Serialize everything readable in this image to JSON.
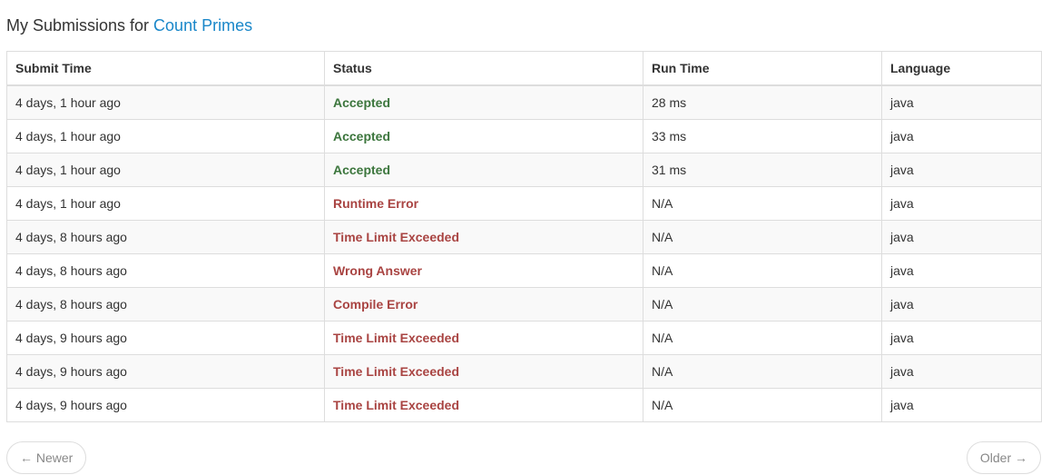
{
  "header": {
    "prefix": "My Submissions for ",
    "problem_link": "Count Primes"
  },
  "table": {
    "columns": [
      "Submit Time",
      "Status",
      "Run Time",
      "Language"
    ],
    "rows": [
      {
        "time": "4 days, 1 hour ago",
        "status": "Accepted",
        "runtime": "28 ms",
        "language": "java"
      },
      {
        "time": "4 days, 1 hour ago",
        "status": "Accepted",
        "runtime": "33 ms",
        "language": "java"
      },
      {
        "time": "4 days, 1 hour ago",
        "status": "Accepted",
        "runtime": "31 ms",
        "language": "java"
      },
      {
        "time": "4 days, 1 hour ago",
        "status": "Runtime Error",
        "runtime": "N/A",
        "language": "java"
      },
      {
        "time": "4 days, 8 hours ago",
        "status": "Time Limit Exceeded",
        "runtime": "N/A",
        "language": "java"
      },
      {
        "time": "4 days, 8 hours ago",
        "status": "Wrong Answer",
        "runtime": "N/A",
        "language": "java"
      },
      {
        "time": "4 days, 8 hours ago",
        "status": "Compile Error",
        "runtime": "N/A",
        "language": "java"
      },
      {
        "time": "4 days, 9 hours ago",
        "status": "Time Limit Exceeded",
        "runtime": "N/A",
        "language": "java"
      },
      {
        "time": "4 days, 9 hours ago",
        "status": "Time Limit Exceeded",
        "runtime": "N/A",
        "language": "java"
      },
      {
        "time": "4 days, 9 hours ago",
        "status": "Time Limit Exceeded",
        "runtime": "N/A",
        "language": "java"
      }
    ]
  },
  "pager": {
    "newer_arrow": "←",
    "newer_label": "Newer",
    "older_label": "Older",
    "older_arrow": "→"
  },
  "colors": {
    "link": "#1a87c9",
    "accepted": "#3c763d",
    "error": "#a94442"
  }
}
